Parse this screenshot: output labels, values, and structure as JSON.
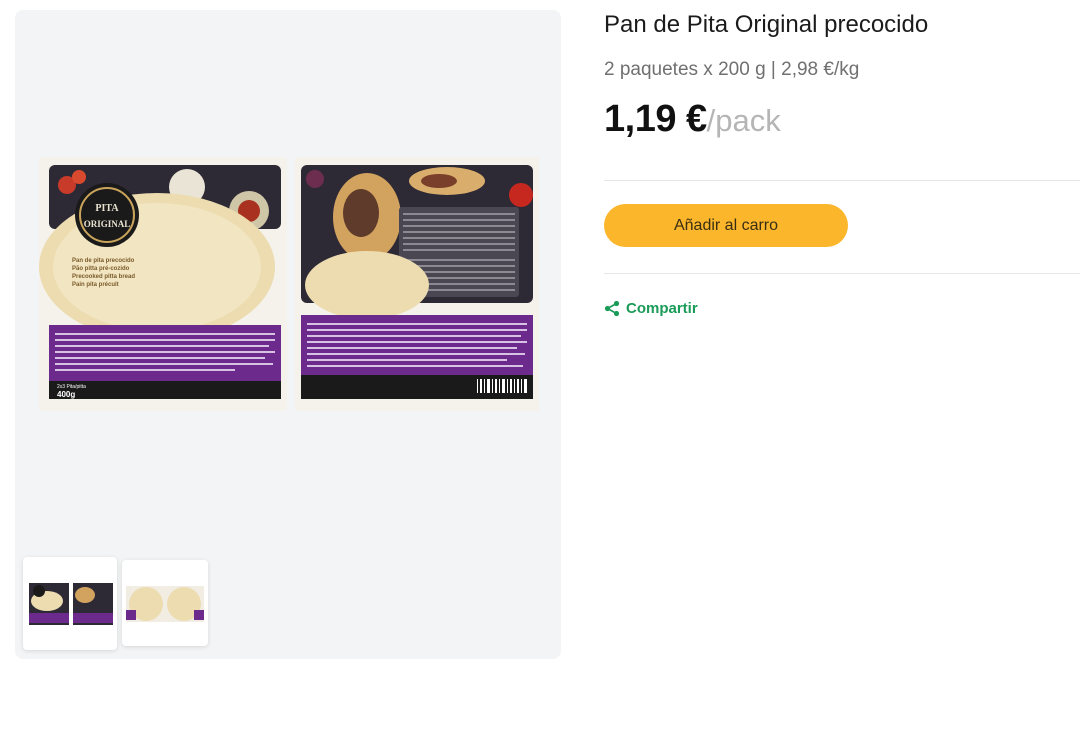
{
  "product": {
    "title": "Pan de Pita Original precocido",
    "subtitle": "2 paquetes x 200 g | 2,98 €/kg",
    "price": "1,19 €",
    "price_unit": "/pack"
  },
  "actions": {
    "add_to_cart": "Añadir al carro",
    "share": "Compartir"
  },
  "packaging": {
    "logo_line1": "PITA",
    "logo_line2": "ORIGINAL",
    "desc_lines": [
      "Pan de pita precocido",
      "Pão pitta pré-cozido",
      "Precooked pitta bread",
      "Pain pita précuit"
    ],
    "count": "2x3 Pita/pitta",
    "weight": "400g"
  },
  "colors": {
    "accent": "#fbb62c",
    "share": "#1a9b58",
    "package_purple": "#6b2a8c",
    "package_dark": "#2e2a35"
  },
  "icons": {
    "share": "share-icon"
  }
}
